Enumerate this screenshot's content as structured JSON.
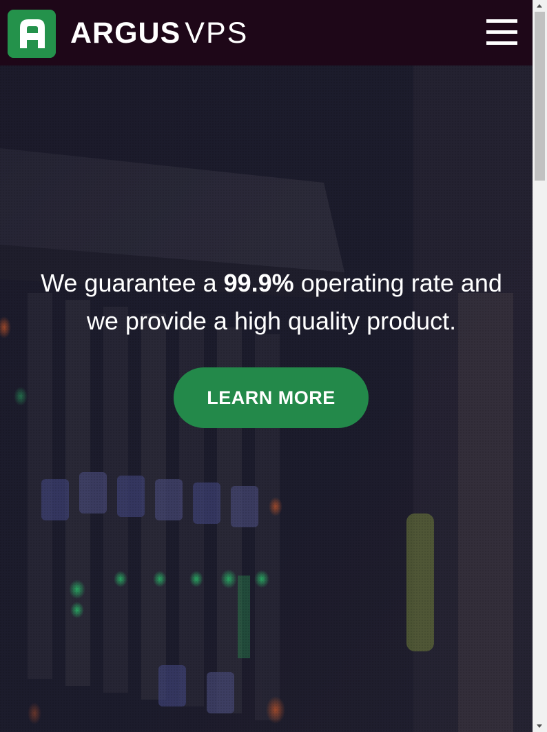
{
  "navbar": {
    "logo_letter": "A",
    "brand_bold": "ARGUS",
    "brand_light": "VPS",
    "menu_icon": "hamburger-menu-icon"
  },
  "hero": {
    "line1_before": "We guarantee a ",
    "line1_bold": "99.9%",
    "line1_after": " operating rate and",
    "line2": "we provide a high quality product.",
    "cta_label": "LEARN MORE",
    "background": "server-rack-photo"
  },
  "colors": {
    "navbar_bg": "#1e0718",
    "brand_green": "#24924b",
    "cta_green": "#23894a",
    "text_white": "#ffffff",
    "hero_overlay": "#1b1a2a"
  },
  "scrollbar": {
    "up_icon": "scroll-up-arrow-icon",
    "down_icon": "scroll-down-arrow-icon"
  }
}
